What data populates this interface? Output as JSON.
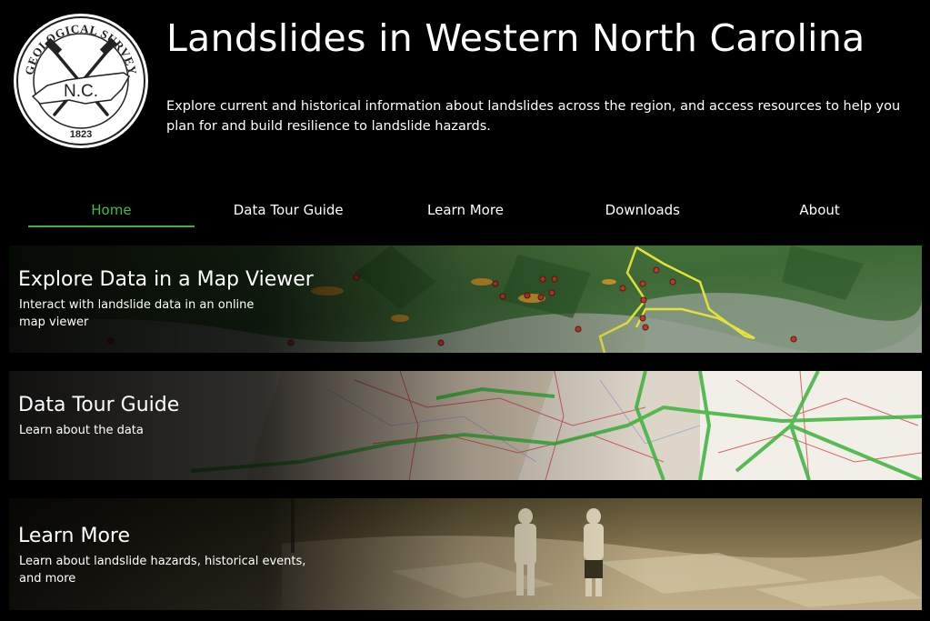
{
  "header": {
    "title": "Landslides in Western North Carolina",
    "subtitle": "Explore current and historical information about landslides across the region, and access resources to help you plan for and build resilience to landslide hazards."
  },
  "logo": {
    "top_text": "GEOLOGICAL SURVEY",
    "center_text": "N.C.",
    "year": "1823"
  },
  "nav": {
    "active": "Home",
    "accent_color": "#3cb33c",
    "items": [
      {
        "label": "Home"
      },
      {
        "label": "Data Tour Guide"
      },
      {
        "label": "Learn More"
      },
      {
        "label": "Downloads"
      },
      {
        "label": "About"
      }
    ]
  },
  "cards": [
    {
      "title": "Explore Data in a Map Viewer",
      "description": "Interact with landslide data in an online map viewer",
      "background": "landslide-map-image"
    },
    {
      "title": "Data Tour Guide",
      "description": "Learn about the data",
      "background": "road-map-image"
    },
    {
      "title": "Learn More",
      "description": "Learn about landslide hazards, historical events, and more",
      "background": "historical-photo-image"
    }
  ]
}
